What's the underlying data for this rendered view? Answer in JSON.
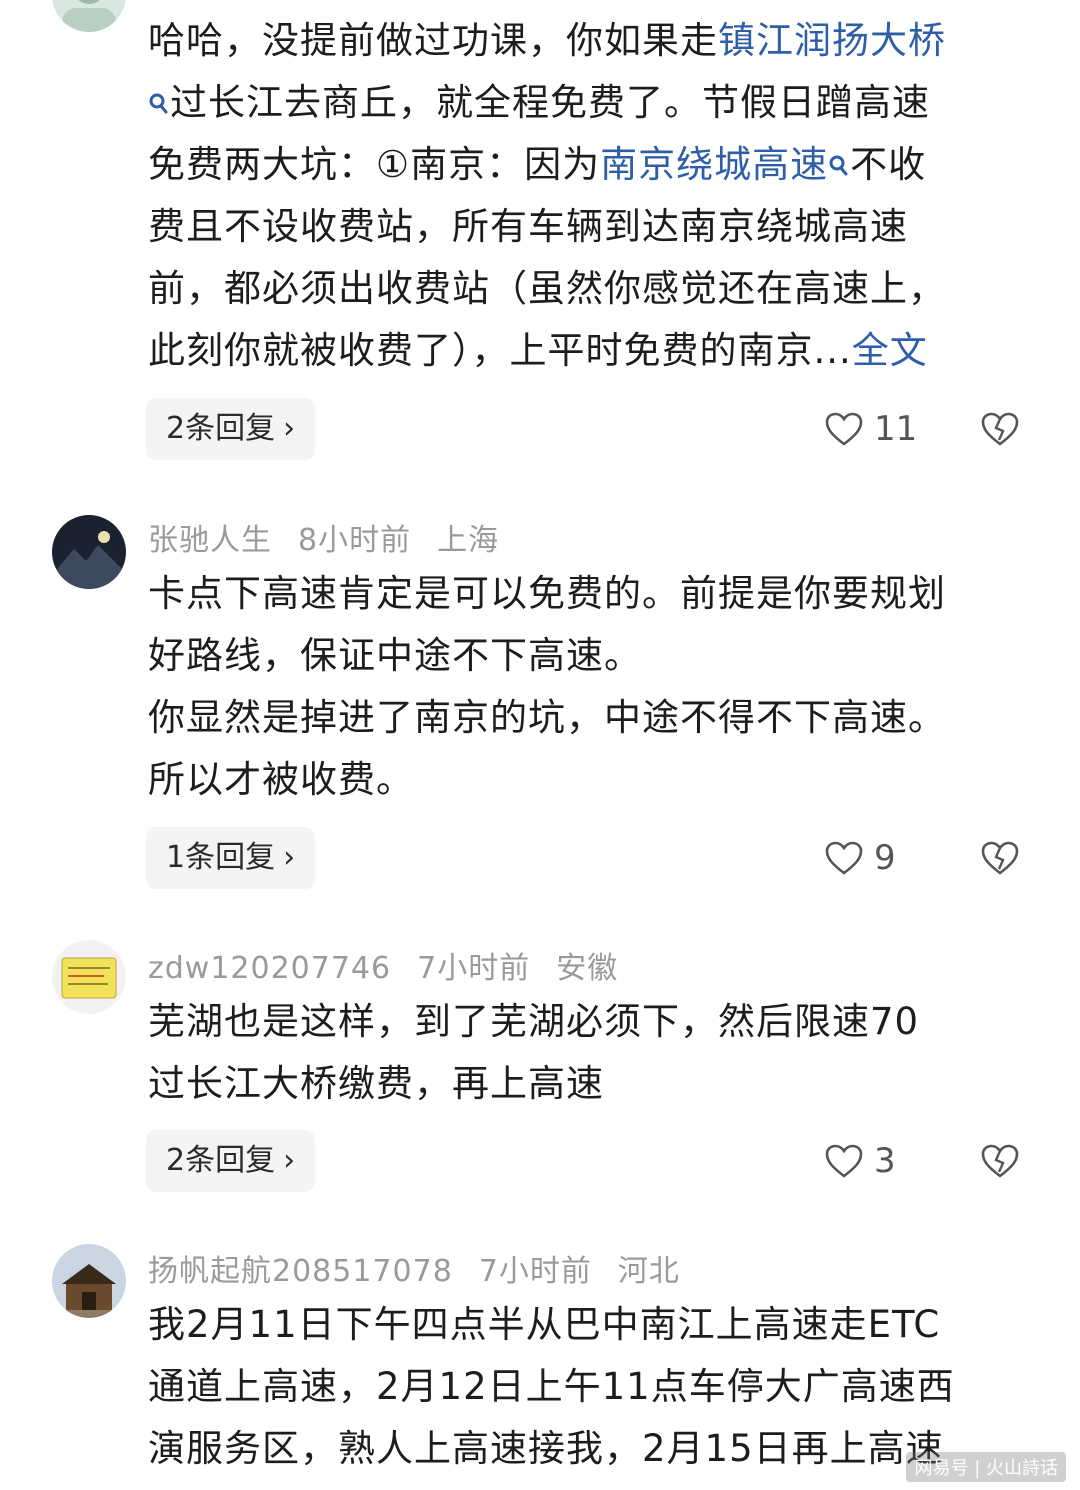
{
  "comments": [
    {
      "body_lines": [
        [
          "哈哈，没提前做过功课，你如果走",
          {
            "link": "镇江润扬大桥"
          }
        ],
        [
          {
            "search": true
          },
          "过长江去商丘，就全程免费了。节假日蹭高速"
        ],
        [
          "免费两大坑：①南京：因为",
          {
            "link": "南京绕城高速"
          },
          {
            "search": true
          },
          "不收"
        ],
        [
          "费且不设收费站，所有车辆到达南京绕城高速"
        ],
        [
          "前，都必须出收费站（虽然你感觉还在高速上，"
        ],
        [
          "此刻你就被收费了），上平时免费的南京...",
          {
            "more": "全文"
          }
        ]
      ],
      "reply_label": "2条回复",
      "likes": "11"
    },
    {
      "user": "张驰人生",
      "time": "8小时前",
      "location": "上海",
      "lines": [
        "卡点下高速肯定是可以免费的。前提是你要规划",
        "好路线，保证中途不下高速。",
        "你显然是掉进了南京的坑，中途不得不下高速。",
        "所以才被收费。"
      ],
      "reply_label": "1条回复",
      "likes": "9"
    },
    {
      "user": "zdw120207746",
      "time": "7小时前",
      "location": "安徽",
      "lines": [
        "芜湖也是这样，到了芜湖必须下，然后限速70",
        "过长江大桥缴费，再上高速"
      ],
      "reply_label": "2条回复",
      "likes": "3"
    },
    {
      "user": "扬帆起航208517078",
      "time": "7小时前",
      "location": "河北",
      "lines": [
        "我2月11日下午四点半从巴中南江上高速走ETC",
        "通道上高速，2月12日上午11点车停大广高速西",
        "演服务区，熟人上高速接我，2月15日再上高速"
      ]
    }
  ],
  "watermark": "网易号 | 火山詩话",
  "colors": {
    "link": "#2f5ea8",
    "meta": "#9a9a9a",
    "chip_bg": "#f4f4f4"
  }
}
